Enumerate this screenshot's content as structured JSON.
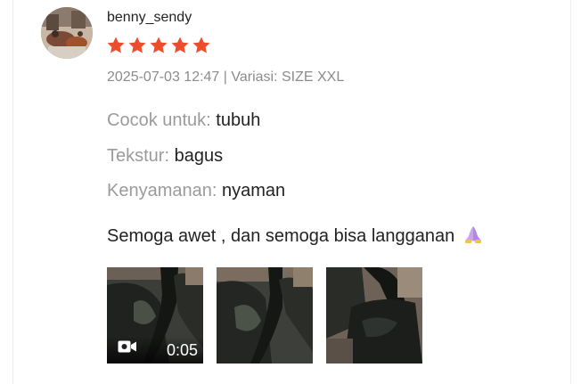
{
  "review": {
    "username": "benny_sendy",
    "rating": 5,
    "star_color": "#ee4d2d",
    "meta": "2025-07-03 12:47 | Variasi: SIZE XXL",
    "attributes": [
      {
        "label": "Cocok untuk:",
        "value": "tubuh"
      },
      {
        "label": "Tekstur:",
        "value": "bagus"
      },
      {
        "label": "Kenyamanan:",
        "value": "nyaman"
      }
    ],
    "comment": "Semoga awet , dan semoga bisa langganan",
    "comment_emoji_icon": "folded-hands-icon",
    "media": [
      {
        "type": "video",
        "duration": "0:05",
        "icon": "video-camera-icon"
      },
      {
        "type": "image"
      },
      {
        "type": "image"
      }
    ]
  }
}
